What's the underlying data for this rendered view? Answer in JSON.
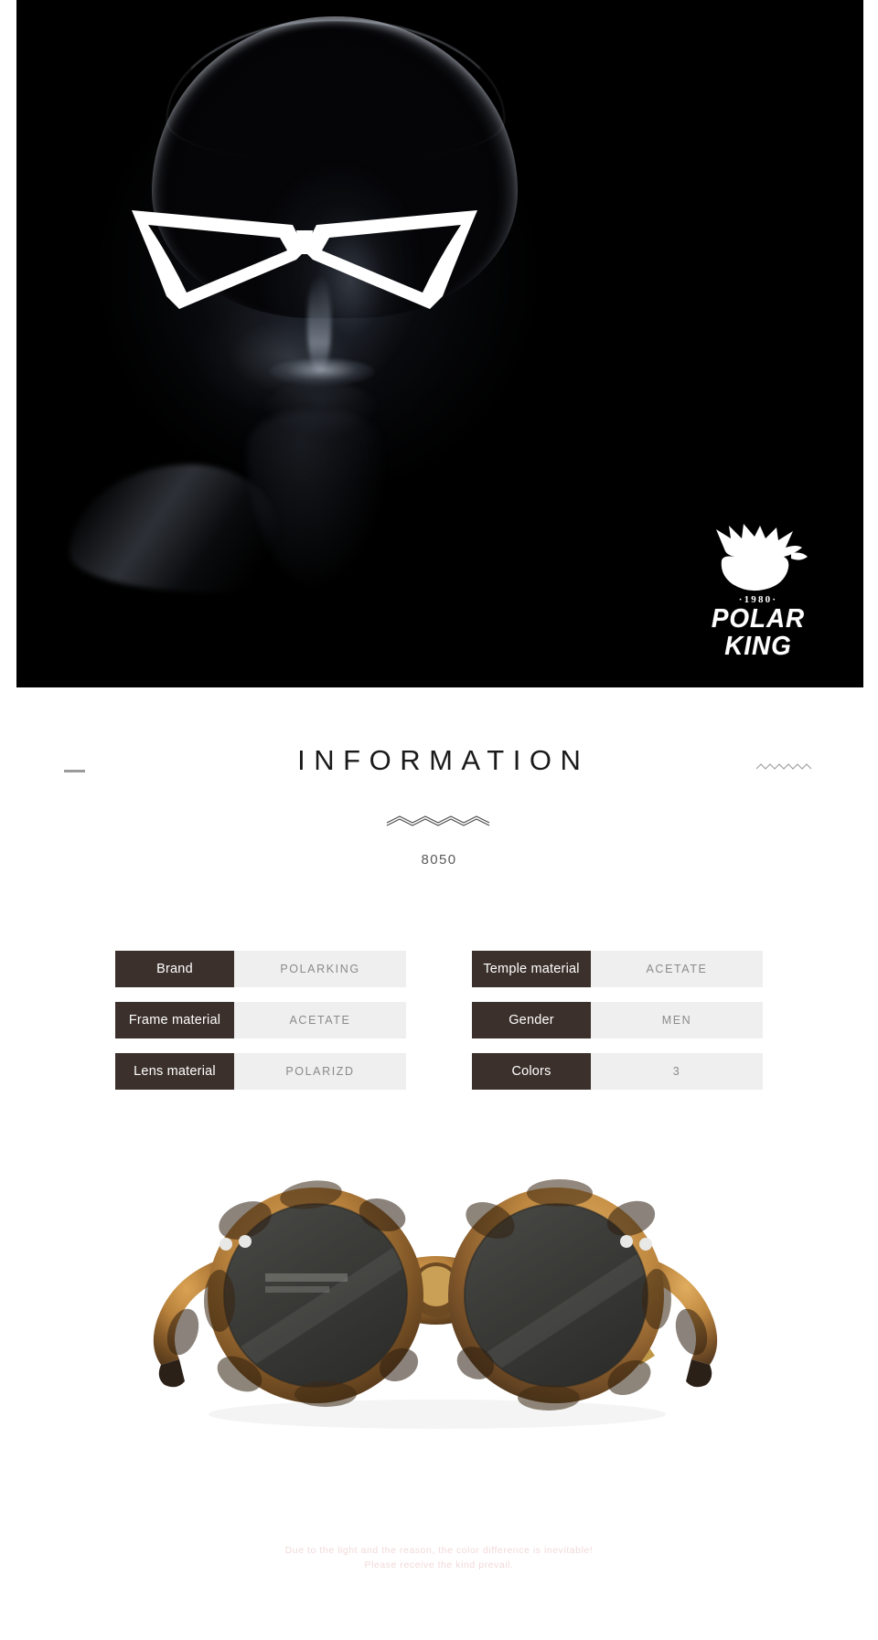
{
  "hero": {
    "alt": "Model wearing white angular cat-eye sunglasses in dramatic low-key lighting",
    "brand_logo": {
      "mark": "gorilla-king-crest",
      "year": "·1980·",
      "wordmark": "POLAR KING"
    },
    "background_color": "#000000"
  },
  "information": {
    "title": "INFORMATION",
    "model": "8050",
    "left_dash": "—",
    "ornament_right": "zigzag-thin",
    "ornament_center": "zigzag-diamond"
  },
  "specs": {
    "left_column": [
      {
        "label": "Brand",
        "value": "POLARKING"
      },
      {
        "label": "Frame material",
        "value": "ACETATE"
      },
      {
        "label": "Lens material",
        "value": "POLARIZD"
      }
    ],
    "right_column": [
      {
        "label": "Temple material",
        "value": "ACETATE"
      },
      {
        "label": "Gender",
        "value": "MEN"
      },
      {
        "label": "Colors",
        "value": "3"
      }
    ],
    "label_color": "#3b302b",
    "value_bg_color": "#efefef",
    "value_text_color": "#8a8a8a"
  },
  "product_photo": {
    "alt": "Round tortoiseshell acetate sunglasses with dark grey polarized lenses",
    "frame_color": "tortoiseshell",
    "lens_color": "#3a3a38"
  },
  "disclaimer": {
    "line1": "Due to the light and the reason, the color difference is inevitable!",
    "line2": "Please receive the kind prevail.",
    "color": "#f3d9da"
  }
}
